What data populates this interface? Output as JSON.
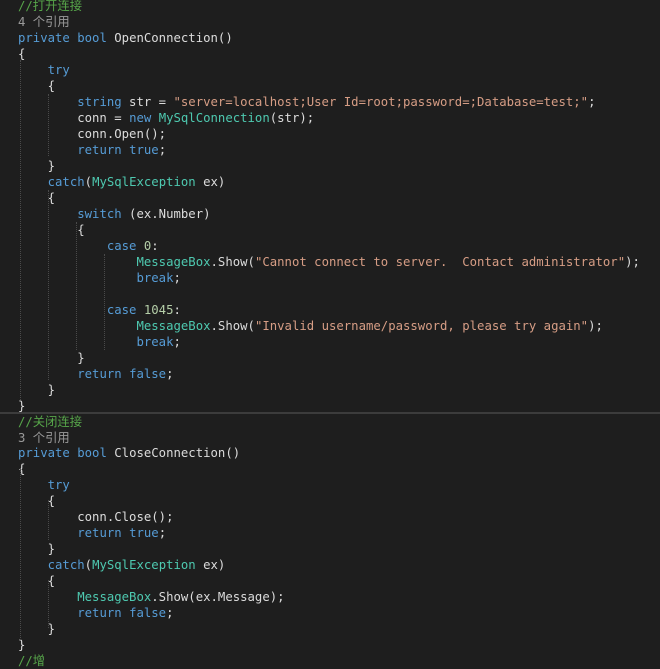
{
  "colors": {
    "background": "#1e1e1e",
    "keyword": "#569cd6",
    "type": "#4ec9b0",
    "string": "#d69d85",
    "comment": "#57a64a",
    "codelens": "#9a9a9a",
    "plain": "#dcdcdc",
    "number": "#b5cea8"
  },
  "lines": [
    [
      {
        "t": "cm",
        "v": "//打开连接"
      }
    ],
    [
      {
        "t": "ref",
        "v": "4 个引用"
      }
    ],
    [
      {
        "t": "kw",
        "v": "private"
      },
      {
        "t": "pl",
        "v": " "
      },
      {
        "t": "kw",
        "v": "bool"
      },
      {
        "t": "pl",
        "v": " OpenConnection()"
      }
    ],
    [
      {
        "t": "pl",
        "v": "{"
      }
    ],
    [
      {
        "t": "pl",
        "v": "    "
      },
      {
        "t": "kw",
        "v": "try"
      }
    ],
    [
      {
        "t": "pl",
        "v": "    {"
      }
    ],
    [
      {
        "t": "pl",
        "v": "        "
      },
      {
        "t": "kw",
        "v": "string"
      },
      {
        "t": "pl",
        "v": " str = "
      },
      {
        "t": "str",
        "v": "\"server=localhost;User Id=root;password=;Database=test;\""
      },
      {
        "t": "pl",
        "v": ";"
      }
    ],
    [
      {
        "t": "pl",
        "v": "        conn = "
      },
      {
        "t": "kw",
        "v": "new"
      },
      {
        "t": "pl",
        "v": " "
      },
      {
        "t": "type",
        "v": "MySqlConnection"
      },
      {
        "t": "pl",
        "v": "(str);"
      }
    ],
    [
      {
        "t": "pl",
        "v": "        conn.Open();"
      }
    ],
    [
      {
        "t": "pl",
        "v": "        "
      },
      {
        "t": "kw",
        "v": "return"
      },
      {
        "t": "pl",
        "v": " "
      },
      {
        "t": "kw",
        "v": "true"
      },
      {
        "t": "pl",
        "v": ";"
      }
    ],
    [
      {
        "t": "pl",
        "v": "    }"
      }
    ],
    [
      {
        "t": "pl",
        "v": "    "
      },
      {
        "t": "kw",
        "v": "catch"
      },
      {
        "t": "pl",
        "v": "("
      },
      {
        "t": "type",
        "v": "MySqlException"
      },
      {
        "t": "pl",
        "v": " ex)"
      }
    ],
    [
      {
        "t": "pl",
        "v": "    {"
      }
    ],
    [
      {
        "t": "pl",
        "v": "        "
      },
      {
        "t": "kw",
        "v": "switch"
      },
      {
        "t": "pl",
        "v": " (ex.Number)"
      }
    ],
    [
      {
        "t": "pl",
        "v": "        {"
      }
    ],
    [
      {
        "t": "pl",
        "v": "            "
      },
      {
        "t": "kw",
        "v": "case"
      },
      {
        "t": "pl",
        "v": " "
      },
      {
        "t": "num",
        "v": "0"
      },
      {
        "t": "pl",
        "v": ":"
      }
    ],
    [
      {
        "t": "pl",
        "v": "                "
      },
      {
        "t": "type",
        "v": "MessageBox"
      },
      {
        "t": "pl",
        "v": ".Show("
      },
      {
        "t": "str",
        "v": "\"Cannot connect to server.  Contact administrator\""
      },
      {
        "t": "pl",
        "v": ");"
      }
    ],
    [
      {
        "t": "pl",
        "v": "                "
      },
      {
        "t": "kw",
        "v": "break"
      },
      {
        "t": "pl",
        "v": ";"
      }
    ],
    [
      {
        "t": "pl",
        "v": ""
      }
    ],
    [
      {
        "t": "pl",
        "v": "            "
      },
      {
        "t": "kw",
        "v": "case"
      },
      {
        "t": "pl",
        "v": " "
      },
      {
        "t": "num",
        "v": "1045"
      },
      {
        "t": "pl",
        "v": ":"
      }
    ],
    [
      {
        "t": "pl",
        "v": "                "
      },
      {
        "t": "type",
        "v": "MessageBox"
      },
      {
        "t": "pl",
        "v": ".Show("
      },
      {
        "t": "str",
        "v": "\"Invalid username/password, please try again\""
      },
      {
        "t": "pl",
        "v": ");"
      }
    ],
    [
      {
        "t": "pl",
        "v": "                "
      },
      {
        "t": "kw",
        "v": "break"
      },
      {
        "t": "pl",
        "v": ";"
      }
    ],
    [
      {
        "t": "pl",
        "v": "        }"
      }
    ],
    [
      {
        "t": "pl",
        "v": "        "
      },
      {
        "t": "kw",
        "v": "return"
      },
      {
        "t": "pl",
        "v": " "
      },
      {
        "t": "kw",
        "v": "false"
      },
      {
        "t": "pl",
        "v": ";"
      }
    ],
    [
      {
        "t": "pl",
        "v": "    }"
      }
    ],
    [
      {
        "t": "pl",
        "v": "}"
      }
    ],
    [
      {
        "t": "cm",
        "v": "//关闭连接"
      }
    ],
    [
      {
        "t": "ref",
        "v": "3 个引用"
      }
    ],
    [
      {
        "t": "kw",
        "v": "private"
      },
      {
        "t": "pl",
        "v": " "
      },
      {
        "t": "kw",
        "v": "bool"
      },
      {
        "t": "pl",
        "v": " CloseConnection()"
      }
    ],
    [
      {
        "t": "pl",
        "v": "{"
      }
    ],
    [
      {
        "t": "pl",
        "v": "    "
      },
      {
        "t": "kw",
        "v": "try"
      }
    ],
    [
      {
        "t": "pl",
        "v": "    {"
      }
    ],
    [
      {
        "t": "pl",
        "v": "        conn.Close();"
      }
    ],
    [
      {
        "t": "pl",
        "v": "        "
      },
      {
        "t": "kw",
        "v": "return"
      },
      {
        "t": "pl",
        "v": " "
      },
      {
        "t": "kw",
        "v": "true"
      },
      {
        "t": "pl",
        "v": ";"
      }
    ],
    [
      {
        "t": "pl",
        "v": "    }"
      }
    ],
    [
      {
        "t": "pl",
        "v": "    "
      },
      {
        "t": "kw",
        "v": "catch"
      },
      {
        "t": "pl",
        "v": "("
      },
      {
        "t": "type",
        "v": "MySqlException"
      },
      {
        "t": "pl",
        "v": " ex)"
      }
    ],
    [
      {
        "t": "pl",
        "v": "    {"
      }
    ],
    [
      {
        "t": "pl",
        "v": "        "
      },
      {
        "t": "type",
        "v": "MessageBox"
      },
      {
        "t": "pl",
        "v": ".Show(ex.Message);"
      }
    ],
    [
      {
        "t": "pl",
        "v": "        "
      },
      {
        "t": "kw",
        "v": "return"
      },
      {
        "t": "pl",
        "v": " "
      },
      {
        "t": "kw",
        "v": "false"
      },
      {
        "t": "pl",
        "v": ";"
      }
    ],
    [
      {
        "t": "pl",
        "v": "    }"
      }
    ],
    [
      {
        "t": "pl",
        "v": "}"
      }
    ],
    [
      {
        "t": "cut",
        "v": "//增"
      }
    ]
  ]
}
